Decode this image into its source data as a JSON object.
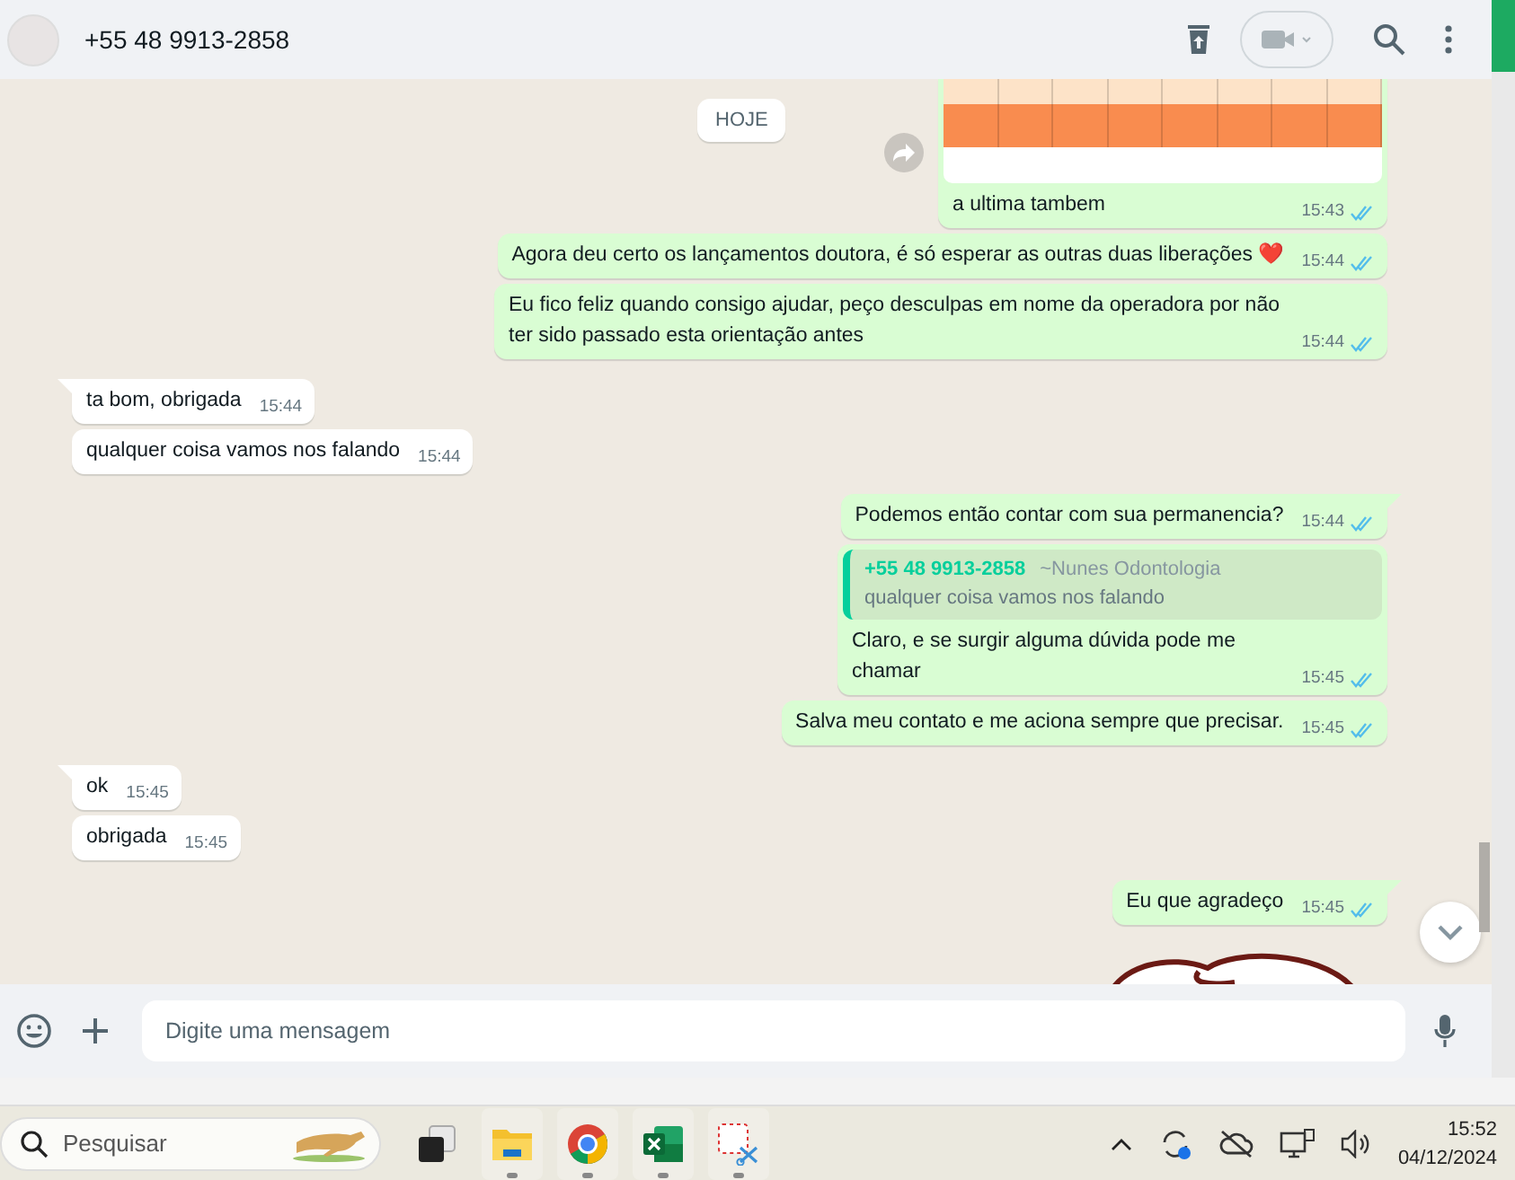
{
  "header": {
    "title": "+55 48 9913-2858"
  },
  "date_chip": "HOJE",
  "messages": [
    {
      "kind": "image",
      "outgoing": true,
      "text": "a ultima tambem",
      "time": "15:43",
      "read": true,
      "tail": false
    },
    {
      "kind": "text",
      "outgoing": true,
      "text": "Agora deu certo os lançamentos doutora, é só esperar as outras duas liberações ❤️",
      "time": "15:44",
      "read": true,
      "tail": false
    },
    {
      "kind": "text",
      "outgoing": true,
      "text": "Eu fico feliz quando consigo ajudar, peço desculpas em nome da operadora por não ter sido passado esta orientação antes",
      "time": "15:44",
      "read": true,
      "tail": false
    },
    {
      "kind": "text",
      "outgoing": false,
      "text": "ta bom, obrigada",
      "time": "15:44",
      "tail": true
    },
    {
      "kind": "text",
      "outgoing": false,
      "text": "qualquer coisa vamos nos falando",
      "time": "15:44",
      "tail": false
    },
    {
      "kind": "text",
      "outgoing": true,
      "text": "Podemos então contar com sua permanencia?",
      "time": "15:44",
      "read": true,
      "tail": true
    },
    {
      "kind": "reply",
      "outgoing": true,
      "quote_author": "+55 48 9913-2858",
      "quote_alias": "~Nunes Odontologia",
      "quote_text": "qualquer coisa vamos nos falando",
      "text": "Claro, e se surgir alguma dúvida pode me chamar",
      "time": "15:45",
      "read": true,
      "tail": false
    },
    {
      "kind": "text",
      "outgoing": true,
      "text": "Salva meu contato e me aciona sempre que precisar.",
      "time": "15:45",
      "read": true,
      "tail": false
    },
    {
      "kind": "text",
      "outgoing": false,
      "text": "ok",
      "time": "15:45",
      "tail": true
    },
    {
      "kind": "text",
      "outgoing": false,
      "text": "obrigada",
      "time": "15:45",
      "tail": false
    },
    {
      "kind": "text",
      "outgoing": true,
      "text": "Eu que agradeço",
      "time": "15:45",
      "read": true,
      "tail": true
    },
    {
      "kind": "sticker",
      "outgoing": true
    }
  ],
  "composer": {
    "placeholder": "Digite uma mensagem"
  },
  "taskbar": {
    "search_placeholder": "Pesquisar",
    "apps": [
      {
        "kind": "taskview",
        "running": false
      },
      {
        "kind": "files",
        "running": true
      },
      {
        "kind": "chrome",
        "running": true
      },
      {
        "kind": "excel",
        "running": true
      },
      {
        "kind": "snip",
        "running": true
      }
    ],
    "time": "15:52",
    "date": "04/12/2024"
  }
}
